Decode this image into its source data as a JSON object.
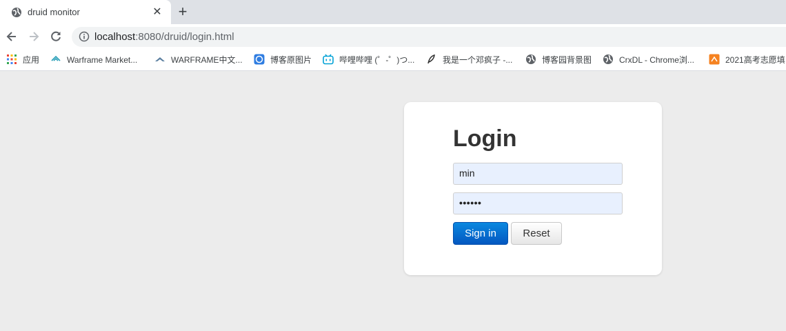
{
  "browser": {
    "tab": {
      "title": "druid monitor",
      "close_glyph": "✕"
    },
    "new_tab_glyph": "+",
    "address": {
      "host": "localhost",
      "rest": ":8080/druid/login.html"
    },
    "bookmarks": [
      {
        "label": "应用",
        "icon": "apps-grid-icon"
      },
      {
        "label": "Warframe Market...",
        "icon": "warframe-market-icon"
      },
      {
        "label": "WARFRAME中文...",
        "icon": "warframe-icon"
      },
      {
        "label": "博客原图片",
        "icon": "blog-icon"
      },
      {
        "label": "哔哩哔哩 (゜-゜)つ...",
        "icon": "bilibili-icon"
      },
      {
        "label": "我是一个邓疯子 -...",
        "icon": "feather-icon"
      },
      {
        "label": "博客园背景图",
        "icon": "globe-icon"
      },
      {
        "label": "CrxDL - Chrome浏...",
        "icon": "globe-icon"
      },
      {
        "label": "2021高考志愿填",
        "icon": "orange-site-icon"
      }
    ]
  },
  "login": {
    "title": "Login",
    "username_value": "min",
    "password_mask": "••••••",
    "signin_label": "Sign in",
    "reset_label": "Reset"
  }
}
